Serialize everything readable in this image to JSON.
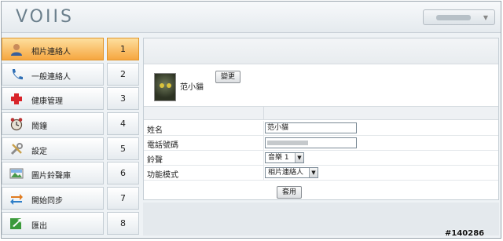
{
  "header": {
    "logo_text": "VOIIS",
    "dropdown_arrow": "▼"
  },
  "sidebar": {
    "items": [
      {
        "label": "相片連絡人",
        "icon": "person-icon",
        "active": true
      },
      {
        "label": "一般連絡人",
        "icon": "phone-icon",
        "active": false
      },
      {
        "label": "健康管理",
        "icon": "medical-cross-icon",
        "active": false
      },
      {
        "label": "鬧鐘",
        "icon": "alarm-clock-icon",
        "active": false
      },
      {
        "label": "設定",
        "icon": "tools-icon",
        "active": false
      },
      {
        "label": "圖片鈴聲庫",
        "icon": "image-library-icon",
        "active": false
      },
      {
        "label": "開始同步",
        "icon": "sync-icon",
        "active": false
      },
      {
        "label": "匯出",
        "icon": "export-icon",
        "active": false
      }
    ]
  },
  "numbers": [
    "1",
    "2",
    "3",
    "4",
    "5",
    "6",
    "7",
    "8"
  ],
  "contact": {
    "name": "范小貓",
    "change_button": "變更"
  },
  "form": {
    "name_label": "姓名",
    "name_value": "范小貓",
    "phone_label": "電話號碼",
    "ringtone_label": "鈴聲",
    "ringtone_value": "音樂 1",
    "mode_label": "功能模式",
    "mode_value": "相片連絡人",
    "apply_button": "套用"
  },
  "watermark": "#140286",
  "colors": {
    "active_bg": "#f6a640",
    "accent_border": "#e0952c"
  }
}
